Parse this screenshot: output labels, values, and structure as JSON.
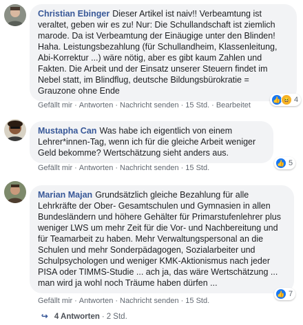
{
  "comments": [
    {
      "author": "Christian Ebinger",
      "text": "Dieser Artikel ist naiv!! Verbeamtung ist veraltet, geben wir es zu! Nur: Die Schullandschaft ist ziemlich marode. Da ist Verbeamtung der Einäugige unter den Blinden! Haha. Leistungsbezahlung (für Schullandheim, Klassenleitung, Abi-Korrektur ...) wäre nötig, aber es gibt kaum Zahlen und Fakten. Die Arbeit und der Einsatz unserer Steuern findet im Nebel statt, im Blindflug, deutsche Bildungsbürokratie = Grauzone ohne Ende",
      "reaction_count": "4",
      "reactions": [
        "like",
        "haha"
      ],
      "actions": {
        "like": "Gefällt mir",
        "reply": "Antworten",
        "message": "Nachricht senden",
        "time": "15 Std.",
        "edited": "Bearbeitet"
      }
    },
    {
      "author": "Mustapha Can",
      "text": "Was habe ich eigentlich von einem Lehrer*innen-Tag, wenn ich für die gleiche Arbeit weniger Geld bekomme? Wertschätzung sieht anders aus.",
      "reaction_count": "5",
      "reactions": [
        "like"
      ],
      "actions": {
        "like": "Gefällt mir",
        "reply": "Antworten",
        "message": "Nachricht senden",
        "time": "15 Std."
      }
    },
    {
      "author": "Marian Majan",
      "text": "Grundsätzlich gleiche Bezahlung für alle Lehrkräfte der Ober- Gesamtschulen und Gymnasien in allen Bundesländern und höhere Gehälter für Primarstufenlehrer plus weniger LWS um mehr Zeit für die Vor- und Nachbereitung und für Teamarbeit zu haben. Mehr Verwaltungspersonal an die Schulen und mehr Sonderpädagogen, Sozialarbeiter und Schulpsychologen und weniger KMK-Aktionismus nach jeder PISA oder TIMMS-Studie ... ach ja, das wäre Wertschätzung ... man wird ja wohl noch Träume haben dürfen ...",
      "reaction_count": "7",
      "reactions": [
        "like"
      ],
      "actions": {
        "like": "Gefällt mir",
        "reply": "Antworten",
        "message": "Nachricht senden",
        "time": "15 Std."
      }
    }
  ],
  "replies": {
    "label": "4 Antworten",
    "time": "2 Std."
  },
  "colors": {
    "author": "#385898",
    "bubble": "#f2f3f5",
    "meta": "#606770",
    "like": "#1877f2"
  }
}
